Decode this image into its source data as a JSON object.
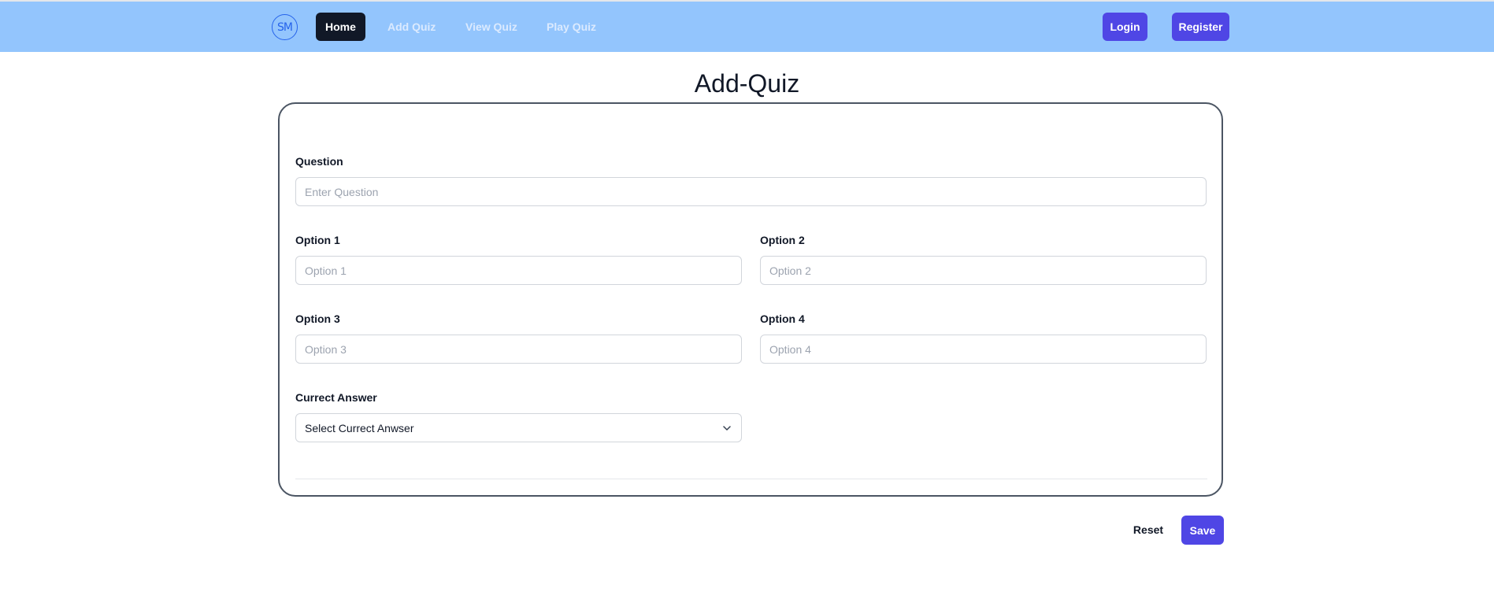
{
  "nav": {
    "logo_text": "SM",
    "links": [
      {
        "label": "Home",
        "active": true
      },
      {
        "label": "Add Quiz",
        "active": false
      },
      {
        "label": "View Quiz",
        "active": false
      },
      {
        "label": "Play Quiz",
        "active": false
      }
    ],
    "login_label": "Login",
    "register_label": "Register"
  },
  "page": {
    "title": "Add-Quiz"
  },
  "form": {
    "question": {
      "label": "Question",
      "placeholder": "Enter Question"
    },
    "option1": {
      "label": "Option 1",
      "placeholder": "Option 1"
    },
    "option2": {
      "label": "Option 2",
      "placeholder": "Option 2"
    },
    "option3": {
      "label": "Option 3",
      "placeholder": "Option 3"
    },
    "option4": {
      "label": "Option 4",
      "placeholder": "Option 4"
    },
    "answer": {
      "label": "Currect Answer",
      "selected": "Select Currect Anwser"
    }
  },
  "actions": {
    "reset_label": "Reset",
    "save_label": "Save"
  },
  "colors": {
    "navbar_bg": "#93c5fd",
    "primary": "#4f46e5",
    "active_nav": "#111827"
  },
  "icons": {
    "logo": "sm-logo-icon",
    "select": "chevron-down-icon"
  }
}
